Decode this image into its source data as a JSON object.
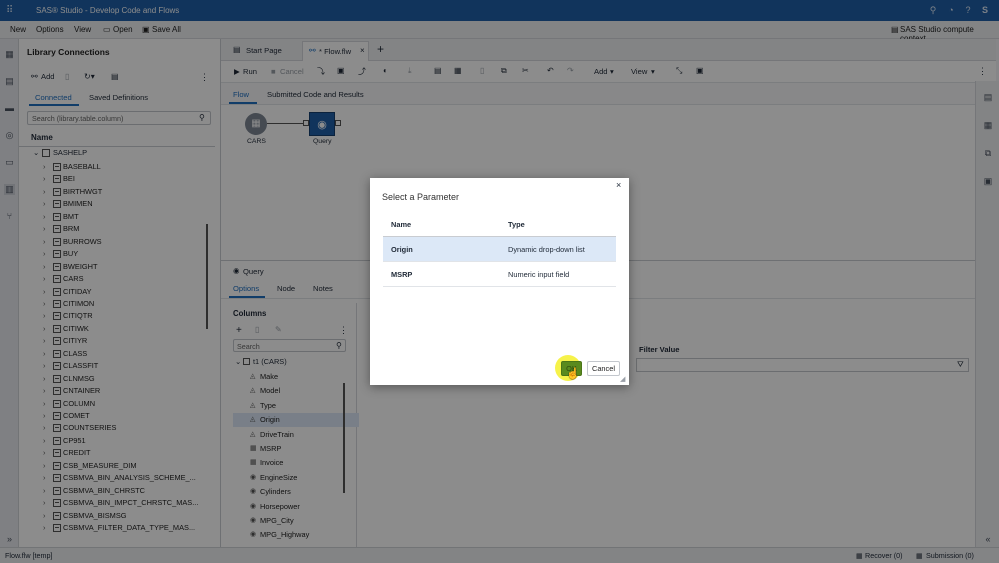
{
  "app": {
    "title": "SAS® Studio - Develop Code and Flows",
    "menu": [
      "New",
      "Options",
      "View",
      "Open",
      "Save All"
    ],
    "context": "SAS Studio compute context"
  },
  "library": {
    "title": "Library Connections",
    "toolbar": {
      "add": "Add"
    },
    "tabs": [
      "Connected",
      "Saved Definitions"
    ],
    "search_placeholder": "Search (library.table.column)",
    "column_header": "Name",
    "root": "SASHELP",
    "items": [
      "BASEBALL",
      "BEI",
      "BIRTHWGT",
      "BMIMEN",
      "BMT",
      "BRM",
      "BURROWS",
      "BUY",
      "BWEIGHT",
      "CARS",
      "CITIDAY",
      "CITIMON",
      "CITIQTR",
      "CITIWK",
      "CITIYR",
      "CLASS",
      "CLASSFIT",
      "CLNMSG",
      "CNTAINER",
      "COLUMN",
      "COMET",
      "COUNTSERIES",
      "CP951",
      "CREDIT",
      "CSB_MEASURE_DIM",
      "CSBMVA_BIN_ANALYSIS_SCHEME_...",
      "CSBMVA_BIN_CHRSTC",
      "CSBMVA_BIN_IMPCT_CHRSTC_MAS...",
      "CSBMVA_BISMSG",
      "CSBMVA_FILTER_DATA_TYPE_MAS..."
    ]
  },
  "editor": {
    "tabs": [
      "Start Page",
      "* Flow.flw"
    ],
    "toolbar": {
      "run": "Run",
      "cancel": "Cancel",
      "add": "Add",
      "view": "View"
    },
    "subtabs": [
      "Flow",
      "Submitted Code and Results"
    ],
    "nodes": [
      {
        "label": "CARS"
      },
      {
        "label": "Query"
      }
    ]
  },
  "query": {
    "title": "Query",
    "tabs": [
      "Options",
      "Node",
      "Notes"
    ],
    "columns_title": "Columns",
    "search_placeholder": "Search",
    "table": "t1 (CARS)",
    "columns": [
      "Make",
      "Model",
      "Type",
      "Origin",
      "DriveTrain",
      "MSRP",
      "Invoice",
      "EngineSize",
      "Cylinders",
      "Horsepower",
      "MPG_City",
      "MPG_Highway"
    ],
    "filter_value_header": "Filter Value"
  },
  "dialog": {
    "title": "Select a Parameter",
    "headers": [
      "Name",
      "Type"
    ],
    "rows": [
      {
        "name": "Origin",
        "type": "Dynamic drop-down list"
      },
      {
        "name": "MSRP",
        "type": "Numeric input field"
      }
    ],
    "ok": "OK",
    "cancel": "Cancel"
  },
  "status": {
    "file": "Flow.flw [temp]",
    "recover": "Recover (0)",
    "submission": "Submission (0)"
  },
  "colors": {
    "titlebar": "#1f5fa8",
    "accent": "#1f6fc0",
    "selected_row": "#dce8f7",
    "ok_button": "#5a8a1e",
    "cursor_highlight": "#f4f02a"
  }
}
